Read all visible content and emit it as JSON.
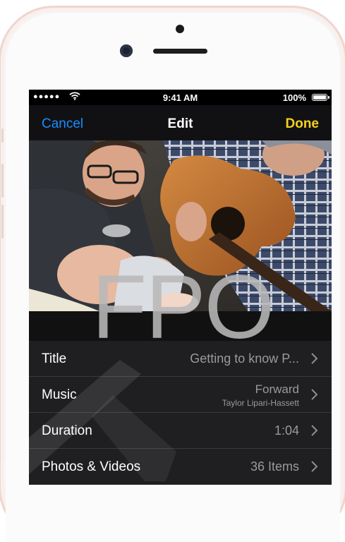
{
  "status_bar": {
    "signal": "●●●●●",
    "time": "9:41 AM",
    "battery": "100%"
  },
  "nav": {
    "cancel": "Cancel",
    "title": "Edit",
    "done": "Done"
  },
  "overlay": {
    "placeholder": "FPO"
  },
  "settings": [
    {
      "label": "Title",
      "value": "Getting to know P..."
    },
    {
      "label": "Music",
      "value": "Forward",
      "subtitle": "Taylor Lipari-Hassett"
    },
    {
      "label": "Duration",
      "value": "1:04"
    },
    {
      "label": "Photos & Videos",
      "value": "36 Items"
    }
  ],
  "colors": {
    "cancel": "#1a8cff",
    "done": "#f5d01f",
    "value_text": "#9a9a9e"
  },
  "icons": [
    "wifi-icon",
    "battery-icon",
    "chevron-right-icon"
  ]
}
